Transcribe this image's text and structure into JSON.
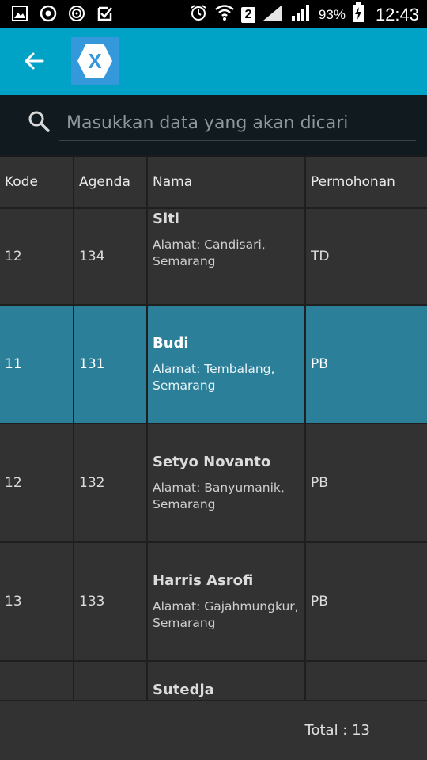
{
  "status_bar": {
    "sim_number": "2",
    "battery_percent": "93%",
    "time": "12:43"
  },
  "app_bar": {
    "logo_letter": "X"
  },
  "search": {
    "placeholder": "Masukkan data yang akan dicari",
    "value": ""
  },
  "table": {
    "columns": [
      "Kode",
      "Agenda",
      "Nama",
      "Permohonan"
    ],
    "rows": [
      {
        "kode": "12",
        "agenda": "134",
        "nama": "Siti",
        "alamat": "Alamat: Candisari, Semarang",
        "permohonan": "TD"
      },
      {
        "kode": "11",
        "agenda": "131",
        "nama": "Budi",
        "alamat": "Alamat: Tembalang, Semarang",
        "permohonan": "PB"
      },
      {
        "kode": "12",
        "agenda": "132",
        "nama": "Setyo Novanto",
        "alamat": "Alamat: Banyumanik, Semarang",
        "permohonan": "PB"
      },
      {
        "kode": "13",
        "agenda": "133",
        "nama": "Harris Asrofi",
        "alamat": "Alamat: Gajahmungkur, Semarang",
        "permohonan": "PB"
      },
      {
        "kode": "",
        "agenda": "",
        "nama": "Sutedja",
        "alamat": "",
        "permohonan": ""
      }
    ]
  },
  "footer": {
    "total": "Total : 13"
  }
}
